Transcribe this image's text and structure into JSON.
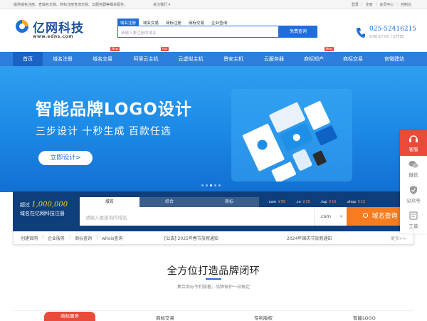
{
  "topbar": {
    "intro": "提供域名注册、查域名交易、商标注册查询交易、云服务器等相关服务。",
    "follow": "关注我们 ▾",
    "links": [
      "登录",
      "注册",
      "会员中心",
      "控制台"
    ]
  },
  "logo": {
    "name": "亿网科技",
    "url": "www.edns.com"
  },
  "search": {
    "tabs": [
      "域名注册",
      "域名交易",
      "商标注册",
      "商标交易",
      "企业查询"
    ],
    "placeholder": "请输入要注册的域名",
    "button": "免费查询"
  },
  "phone": {
    "number": "025-52416215",
    "hours": "9:00-17:00（工作日）"
  },
  "nav": {
    "items": [
      {
        "label": "首页",
        "badge": ""
      },
      {
        "label": "域名注册",
        "badge": ""
      },
      {
        "label": "域名交易",
        "badge": "New"
      },
      {
        "label": "阿里云主机",
        "badge": ""
      },
      {
        "label": "云虚拟主机",
        "badge": "Hot"
      },
      {
        "label": "景安主机",
        "badge": ""
      },
      {
        "label": "云服务器",
        "badge": ""
      },
      {
        "label": "商标知产",
        "badge": ""
      },
      {
        "label": "商标交易",
        "badge": "New"
      },
      {
        "label": "官微建站",
        "badge": ""
      }
    ]
  },
  "banner": {
    "title": "智能品牌LOGO设计",
    "subtitle": "三步设计  十秒生成  百款任选",
    "cta": "立即设计>"
  },
  "domain": {
    "promo_prefix": "超过",
    "promo_number": "1,000,000",
    "promo_line2": "域名在亿网科技注册",
    "tabs": [
      "域名",
      "综合",
      "商标"
    ],
    "prices": [
      {
        "ext": ".com",
        "price": "￥55"
      },
      {
        "ext": ".cn",
        "price": "￥25"
      },
      {
        "ext": ".top",
        "price": "￥15"
      },
      {
        "ext": ".shop",
        "price": "￥13"
      }
    ],
    "placeholder": "请输入要查询的域名",
    "suffix": ".com",
    "button": "域名查询"
  },
  "quicklinks": {
    "links": [
      "创建官网",
      "企业服务",
      "商标查询",
      "whois查询"
    ],
    "notice_tag": "[公告]",
    "notice1": "2025年春节放假通知",
    "notice2": "2024年国庆节放假通知",
    "more": "更多>>"
  },
  "sidebar": {
    "items": [
      "客服",
      "微信",
      "公众号",
      "工单"
    ]
  },
  "section": {
    "title": "全方位打造品牌闭环",
    "subtitle": "集合商标专利版著，品牌保护一站搞定",
    "tabs": [
      "商标服务",
      "商标交易",
      "专利版权",
      "智能LOGO"
    ]
  },
  "colors": {
    "primary": "#1e6fd9",
    "nav": "#2e7fdb",
    "accent": "#f67c1f",
    "red": "#ea4a3a",
    "dark": "#0e3f7a"
  }
}
